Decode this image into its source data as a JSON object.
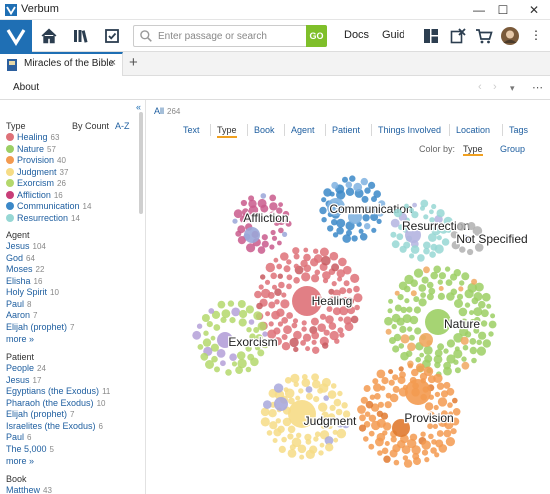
{
  "window": {
    "title": "Verbum",
    "minimize": "—",
    "maximize": "☐",
    "close": "✕"
  },
  "toolbar": {
    "search_placeholder": "Enter passage or search",
    "go_label": "GO",
    "docs_label": "Docs",
    "guides_label": "Guide"
  },
  "tabs": {
    "active_tab": "Miracles of the Bible",
    "close": "×",
    "add": "+"
  },
  "panel": {
    "about_label": "About",
    "back": "‹",
    "forward": "›",
    "menu": "▾",
    "panel_menu": "⋯"
  },
  "sidebar": {
    "collapse": "«",
    "type_heading": "Type",
    "sort_count": "By Count",
    "sort_az": "A-Z",
    "types": [
      {
        "name": "Healing",
        "count": "63",
        "color": "#de7178"
      },
      {
        "name": "Nature",
        "count": "57",
        "color": "#9ccf64"
      },
      {
        "name": "Provision",
        "count": "40",
        "color": "#f39a50"
      },
      {
        "name": "Judgment",
        "count": "37",
        "color": "#f6dc86"
      },
      {
        "name": "Exorcism",
        "count": "26",
        "color": "#b4d86c"
      },
      {
        "name": "Affliction",
        "count": "16",
        "color": "#c83e78"
      },
      {
        "name": "Communication",
        "count": "14",
        "color": "#3b88c8"
      },
      {
        "name": "Resurrection",
        "count": "14",
        "color": "#96d7d4"
      }
    ],
    "agent_heading": "Agent",
    "agents": [
      {
        "name": "Jesus",
        "count": "104"
      },
      {
        "name": "God",
        "count": "64"
      },
      {
        "name": "Moses",
        "count": "22"
      },
      {
        "name": "Elisha",
        "count": "16"
      },
      {
        "name": "Holy Spirit",
        "count": "10"
      },
      {
        "name": "Paul",
        "count": "8"
      },
      {
        "name": "Aaron",
        "count": "7"
      },
      {
        "name": "Elijah (prophet)",
        "count": "7"
      }
    ],
    "agent_more": "more »",
    "patient_heading": "Patient",
    "patients": [
      {
        "name": "People",
        "count": "24"
      },
      {
        "name": "Jesus",
        "count": "17"
      },
      {
        "name": "Egyptians (the Exodus)",
        "count": "11"
      },
      {
        "name": "Pharaoh (the Exodus)",
        "count": "10"
      },
      {
        "name": "Elijah (prophet)",
        "count": "7"
      },
      {
        "name": "Israelites (the Exodus)",
        "count": "6"
      },
      {
        "name": "Paul",
        "count": "6"
      },
      {
        "name": "The 5,000",
        "count": "5"
      }
    ],
    "patient_more": "more »",
    "book_heading": "Book",
    "books": [
      {
        "name": "Matthew",
        "count": "43"
      }
    ]
  },
  "main": {
    "all_label": "All",
    "all_count": "264",
    "filter_tabs": [
      "Text",
      "Type",
      "Book",
      "Agent",
      "Patient",
      "Things Involved",
      "Location",
      "Tags"
    ],
    "active_filter": "Type",
    "color_by_label": "Color by:",
    "color_by_options": [
      "Type",
      "Group"
    ],
    "active_color_by": "Type"
  },
  "clusters": [
    {
      "label": "Affliction",
      "color": "#c95a8c",
      "accent": "#9aa6d8"
    },
    {
      "label": "Communication",
      "color": "#3b88c8",
      "accent": "#7fb2e0"
    },
    {
      "label": "Resurrection",
      "color": "#96d7d4",
      "accent": "#b4b4e0"
    },
    {
      "label": "Not Specified",
      "color": "#b0b0b0",
      "accent": "#9aa6d8"
    },
    {
      "label": "Healing",
      "color": "#de7178",
      "accent": "#c85a60"
    },
    {
      "label": "Nature",
      "color": "#9ccf64",
      "accent": "#f0a860"
    },
    {
      "label": "Exorcism",
      "color": "#b4d86c",
      "accent": "#b4a0d8"
    },
    {
      "label": "Judgment",
      "color": "#f6dc86",
      "accent": "#a8a8dc"
    },
    {
      "label": "Provision",
      "color": "#f39a50",
      "accent": "#e07a30"
    }
  ]
}
